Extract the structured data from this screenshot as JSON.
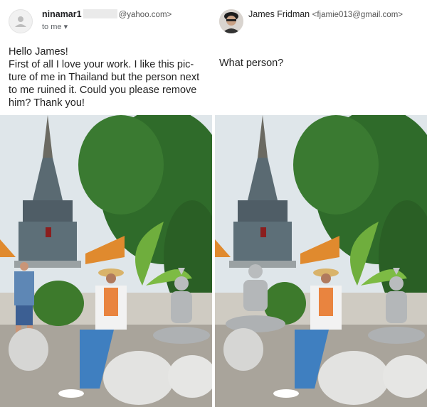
{
  "left": {
    "sender_name": "ninamar1",
    "sender_email": "@yahoo.com>",
    "recipient_label": "to me",
    "chevron": "▾",
    "message_lines": [
      "Hello James!",
      "First of all I love your  work. I like  this pic-",
      "ture of me in Thailand but the person next",
      "to me ruined it.  Could you please remove",
      "him? Thank you!"
    ],
    "photo_icon": "temple-photo-with-man"
  },
  "right": {
    "sender_name": "James Fridman",
    "sender_email": "<fjamie013@gmail.com>",
    "message": "What person?",
    "photo_icon": "temple-photo-with-statue"
  },
  "colors": {
    "sky": "#dfe6ea",
    "foliage": "#2f6b2a",
    "temple": "#5a6a72",
    "statue": "#b9bcbe",
    "roof": "#e08a2e"
  }
}
